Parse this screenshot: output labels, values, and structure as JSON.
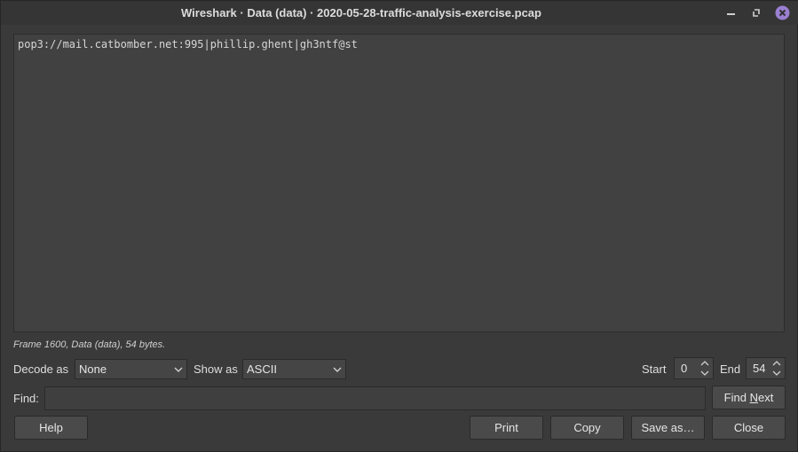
{
  "window": {
    "title": "Wireshark · Data (data) · 2020-05-28-traffic-analysis-exercise.pcap",
    "controls": {
      "minimize": "minimize-icon",
      "maximize": "maximize-icon",
      "close": "close-icon"
    }
  },
  "content": {
    "text": "pop3://mail.catbomber.net:995|phillip.ghent|gh3ntf@st"
  },
  "frame_info": "Frame 1600, Data (data), 54 bytes.",
  "controls": {
    "decode_as_label": "Decode as",
    "decode_as_value": "None",
    "show_as_label": "Show as",
    "show_as_value": "ASCII",
    "start_label": "Start",
    "start_value": "0",
    "end_label": "End",
    "end_value": "54"
  },
  "find": {
    "label": "Find:",
    "value": "",
    "find_next_pre": "Find ",
    "find_next_mnemonic": "N",
    "find_next_post": "ext"
  },
  "buttons": {
    "help": "Help",
    "print": "Print",
    "copy": "Copy",
    "save_as": "Save as…",
    "close": "Close"
  },
  "colors": {
    "background": "#3a3a3a",
    "close_accent": "#9a7fd1"
  }
}
